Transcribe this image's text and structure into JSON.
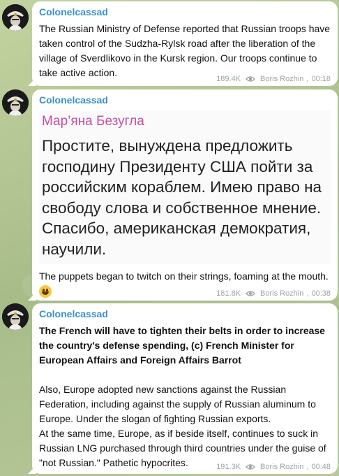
{
  "channel": {
    "name": "Colonelcassad"
  },
  "messages": [
    {
      "sender": "Colonelcassad",
      "text": "The Russian Ministry of Defense reported that Russian troops have taken control of the Sudzha-Rylsk road after the liberation of the village of Sverdlikovo in the Kursk region. Our troops continue to take active action.",
      "views": "189.4K",
      "author": "Boris Rozhin",
      "time": "00:18"
    },
    {
      "sender": "Colonelcassad",
      "quote_author": "Мар’яна Безугла",
      "quote_text": "Простите, вынуждена предложить господину Президенту США пойти за российским кораблем. Имею право на свободу слова и собственное мнение. Спасибо, американская демократия, научили.",
      "text": "The puppets began to twitch on their strings, foaming at the mouth.",
      "emoji": "grinning-face",
      "views": "181.8K",
      "author": "Boris Rozhin",
      "time": "00:38"
    },
    {
      "sender": "Colonelcassad",
      "text_bold": "The French will have to tighten their belts in order to increase the country's defense spending, (c) French Minister for European Affairs and Foreign Affairs Barrot",
      "text_p2": "Also, Europe adopted new sanctions against the Russian Federation, including against the supply of Russian aluminum to Europe. Under the slogan of fighting Russian exports.",
      "text_p3": "At the same time, Europe, as if beside itself, continues to suck in Russian LNG purchased through third countries under the guise of \"not Russian.\" Pathetic hypocrites.",
      "views": "191.3K",
      "author": "Boris Rozhin",
      "time": "00:48"
    }
  ],
  "colors": {
    "sender": "#3a8fd0",
    "quote_author": "#c44ea0",
    "meta": "#9aa3a9",
    "bubble": "#ffffff"
  }
}
